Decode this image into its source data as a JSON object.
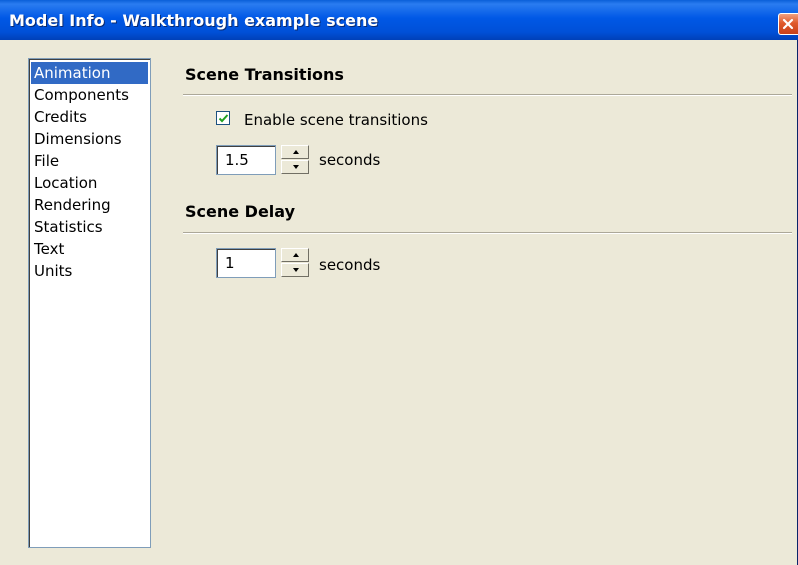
{
  "window": {
    "title": "Model Info - Walkthrough example scene"
  },
  "sidebar": {
    "items": [
      {
        "label": "Animation",
        "selected": true
      },
      {
        "label": "Components"
      },
      {
        "label": "Credits"
      },
      {
        "label": "Dimensions"
      },
      {
        "label": "File"
      },
      {
        "label": "Location"
      },
      {
        "label": "Rendering"
      },
      {
        "label": "Statistics"
      },
      {
        "label": "Text"
      },
      {
        "label": "Units"
      }
    ]
  },
  "scene_transitions": {
    "title": "Scene Transitions",
    "enable_label": "Enable scene transitions",
    "enabled": true,
    "value": "1.5",
    "unit": "seconds"
  },
  "scene_delay": {
    "title": "Scene Delay",
    "value": "1",
    "unit": "seconds"
  },
  "colors": {
    "titlebar": "#0054e3",
    "selection": "#316ac5",
    "dialog_bg": "#ece9d8"
  },
  "icons": {
    "close": "close-icon",
    "check": "checkmark-icon",
    "spin_up": "arrow-up-icon",
    "spin_down": "arrow-down-icon"
  }
}
